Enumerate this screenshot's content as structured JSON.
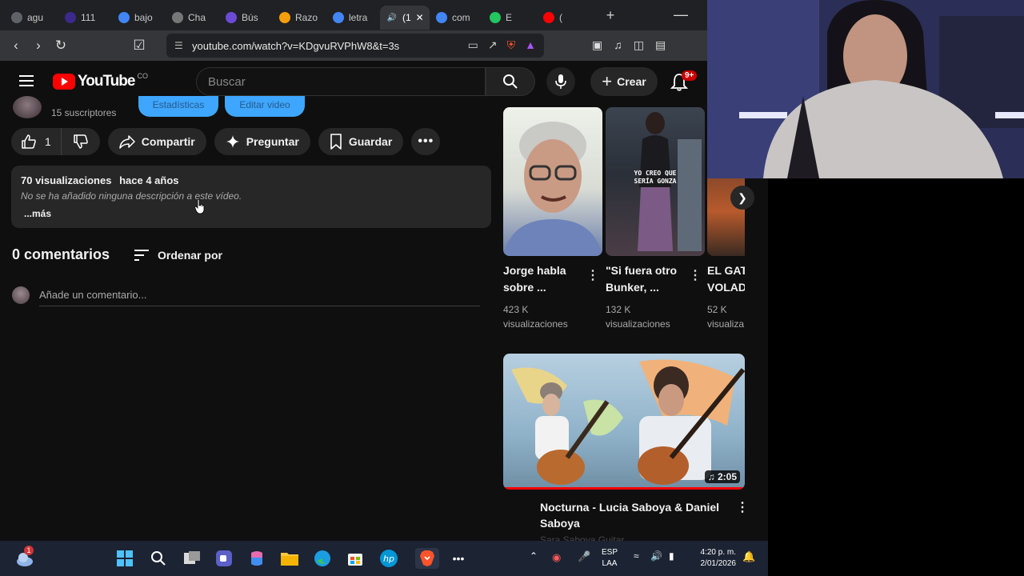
{
  "tabs": [
    {
      "label": "agu",
      "color": "#5f6368"
    },
    {
      "label": "111",
      "color": "#3b2a8c"
    },
    {
      "label": "bajo",
      "color": "#4285f4"
    },
    {
      "label": "Cha",
      "color": "#777777"
    },
    {
      "label": "Bús",
      "color": "#6b4bd6"
    },
    {
      "label": "Razo",
      "color": "#f59e0b"
    },
    {
      "label": "letra",
      "color": "#4285f4"
    },
    {
      "label": "(1",
      "color": "#ffffff",
      "active": true
    },
    {
      "label": "com",
      "color": "#4285f4"
    },
    {
      "label": "E",
      "color": "#22c55e"
    },
    {
      "label": "(",
      "color": "#ff0000"
    }
  ],
  "browser": {
    "url": "youtube.com/watch?v=KDgvuRVPhW8&t=3s",
    "new_tab": "+",
    "minimize": "—"
  },
  "header": {
    "logo_text": "YouTube",
    "country_code": "CO",
    "search_placeholder": "Buscar",
    "create_label": "Crear",
    "notif_badge": "9+"
  },
  "channel": {
    "subscribers": "15 suscriptores",
    "stats_button": "Estadísticas",
    "edit_button": "Editar video"
  },
  "actions": {
    "like_count": "1",
    "share": "Compartir",
    "ask": "Preguntar",
    "save": "Guardar"
  },
  "description": {
    "views": "70 visualizaciones",
    "age": "hace 4 años",
    "text": "No se ha añadido ninguna descripción a este vídeo.",
    "more": "...más"
  },
  "comments": {
    "count": "0 comentarios",
    "sort": "Ordenar por",
    "placeholder": "Añade un comentario..."
  },
  "shorts": [
    {
      "title": "Jorge habla sobre ...",
      "views": "423 K visualizaciones"
    },
    {
      "title": "\"Si fuera otro Bunker, ...",
      "views": "132 K visualizaciones",
      "overlay": "YO CREO QUE SERÍA GONZA"
    },
    {
      "title": "EL GAT VOLAD",
      "views": "52 K visualiza"
    }
  ],
  "video": {
    "title": "Nocturna - Lucia Saboya & Daniel Saboya",
    "channel": "Sara Saboya Guitar",
    "duration": "2:05"
  },
  "taskbar": {
    "lang1": "ESP",
    "lang2": "LAA",
    "time": "4:20 p. m.",
    "date": "2/01/2026",
    "weather_badge": "1"
  }
}
